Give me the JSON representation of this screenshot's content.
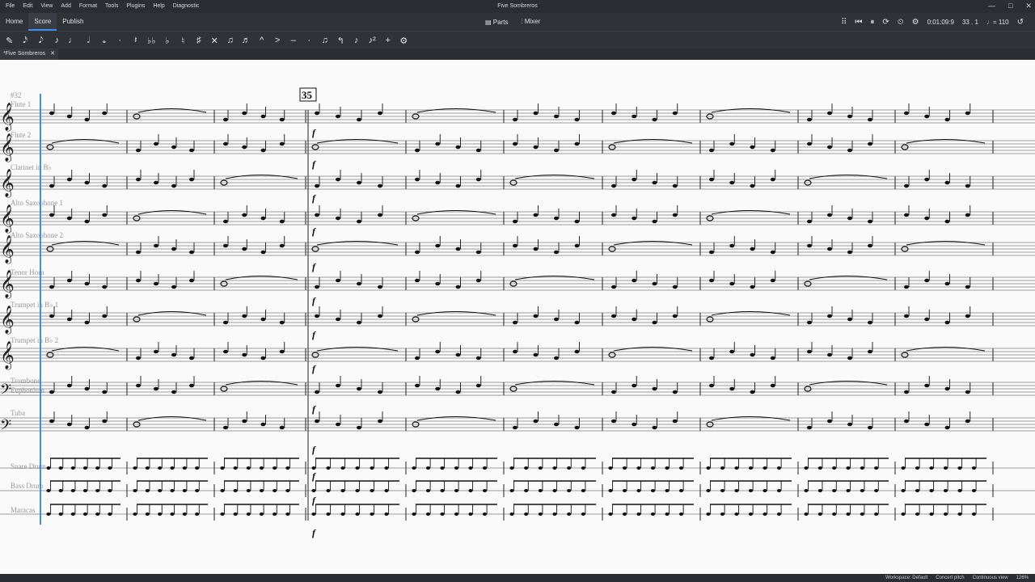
{
  "menubar": {
    "items": [
      "File",
      "Edit",
      "View",
      "Add",
      "Format",
      "Tools",
      "Plugins",
      "Help",
      "Diagnostic"
    ],
    "doc_title": "Five Sombreros",
    "window_controls": [
      "—",
      "□",
      "✕"
    ]
  },
  "tabs": {
    "home": "Home",
    "score": "Score",
    "publish": "Publish",
    "parts": "Parts",
    "mixer": "Mixer"
  },
  "playback": {
    "time": "0:01:09:9",
    "measure_beat": "33 . 1",
    "tempo": "♩= 110"
  },
  "note_input_tools": [
    "✎",
    "𝅘𝅥𝅯",
    "𝅘𝅥𝅮",
    "♪",
    "♩",
    "𝅗𝅥",
    "𝅝",
    "·",
    "𝄽",
    "♭♭",
    "♭",
    "♮",
    "♯",
    "✕",
    "♫",
    "♬",
    "^",
    ">",
    "–",
    "·",
    "♫",
    "↰",
    "♪",
    "♪²",
    "+",
    "⚙"
  ],
  "document_tab": {
    "label": "*Five Sombreros",
    "close": "✕"
  },
  "score": {
    "measure_number": "#32",
    "rehearsal_mark": "35",
    "dynamic": "f",
    "instruments": [
      "Flute 1",
      "Flute 2",
      "Clarinet in B♭",
      "Alto Saxophone 1",
      "Alto Saxophone 2",
      "Tenor Horn",
      "Trumpet in B♭ 1",
      "Trumpet in B♭ 2",
      "Trombone",
      "Euphonium",
      "Tuba",
      "Snare Drum",
      "Bass Drum",
      "Maracas"
    ]
  },
  "statusbar": {
    "workspace": "Workspace: Default",
    "concert_pitch": "Concert pitch",
    "view_mode": "Continuous view",
    "zoom": "126%"
  }
}
